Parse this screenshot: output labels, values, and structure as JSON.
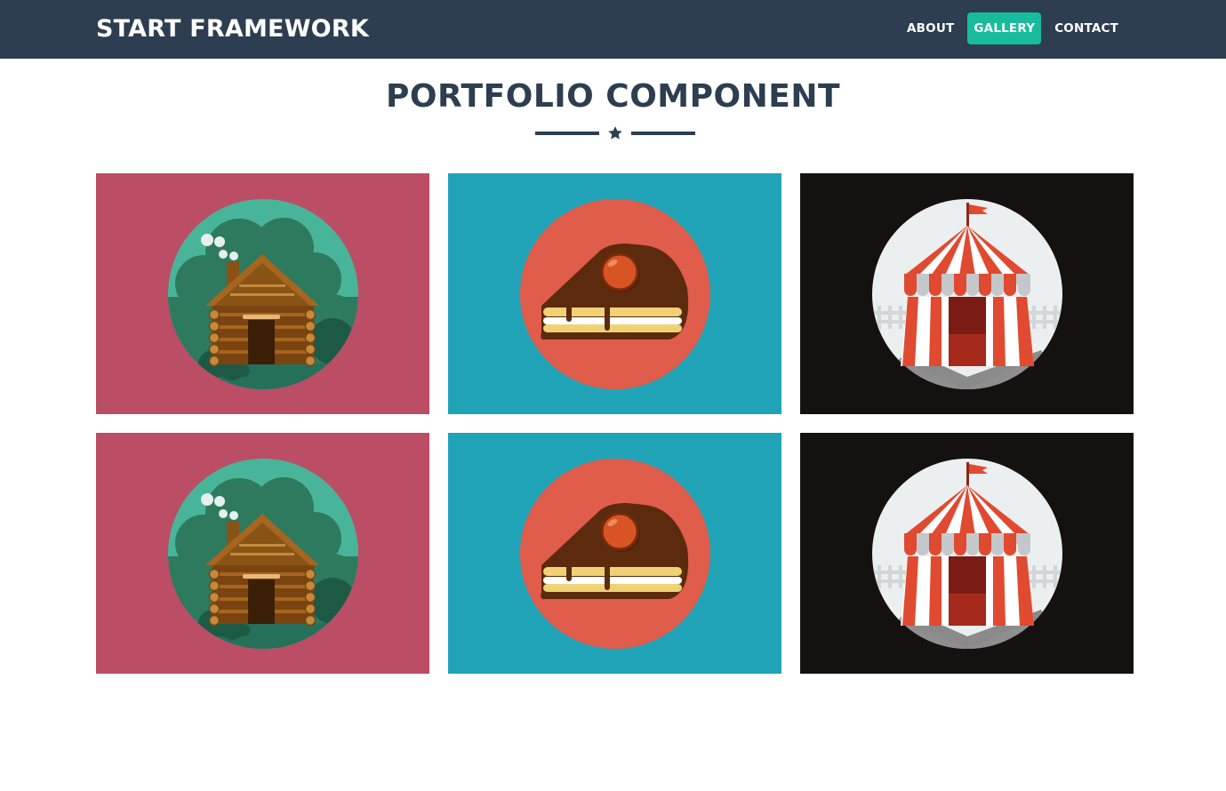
{
  "navbar": {
    "brand": "START FRAMEWORK",
    "links": [
      {
        "label": "ABOUT",
        "active": false
      },
      {
        "label": "GALLERY",
        "active": true
      },
      {
        "label": "CONTACT",
        "active": false
      }
    ],
    "active_color": "#18bc9c",
    "background": "#2c3e50"
  },
  "portfolio": {
    "title": "PORTFOLIO COMPONENT",
    "divider_icon": "star-icon",
    "items": [
      {
        "icon": "cabin-illustration",
        "background": "#bb4d65"
      },
      {
        "icon": "cake-illustration",
        "background": "#21a3b7"
      },
      {
        "icon": "circus-tent-illustration",
        "background": "#141110"
      },
      {
        "icon": "cabin-illustration",
        "background": "#bb4d65"
      },
      {
        "icon": "cake-illustration",
        "background": "#21a3b7"
      },
      {
        "icon": "circus-tent-illustration",
        "background": "#141110"
      }
    ]
  }
}
